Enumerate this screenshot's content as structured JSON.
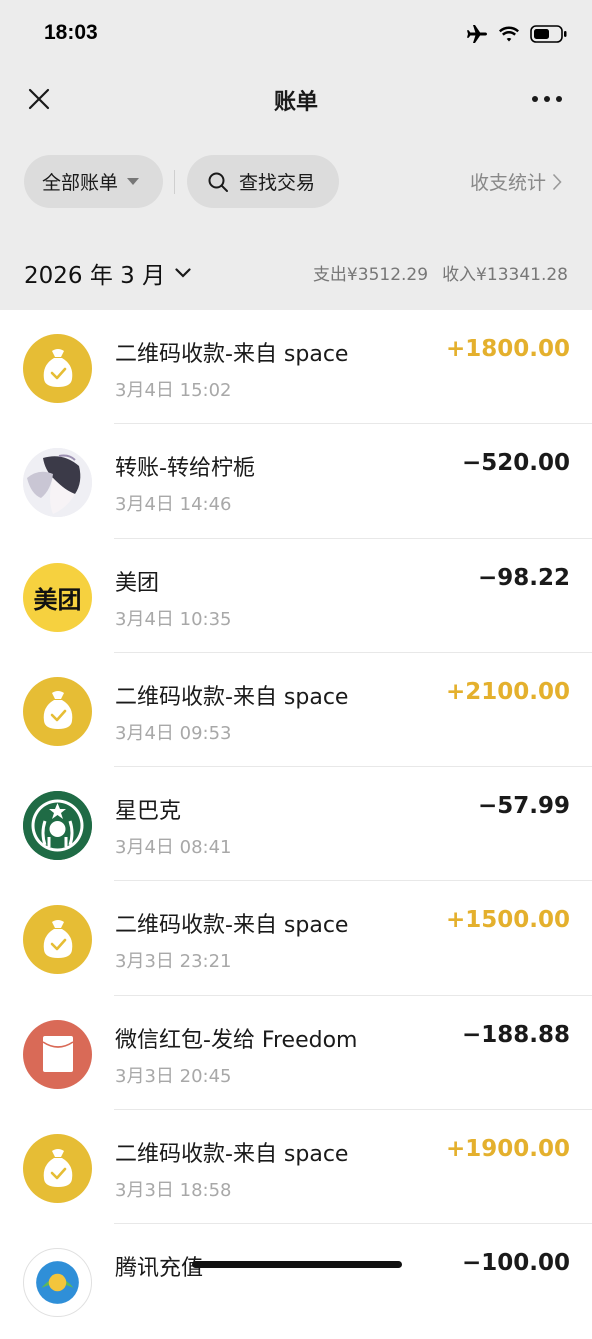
{
  "status_bar": {
    "time": "18:03"
  },
  "nav": {
    "title": "账单"
  },
  "filters": {
    "all_bills": "全部账单",
    "search": "查找交易",
    "stats": "收支统计"
  },
  "month": {
    "label": "2026 年 3 月",
    "expense": "支出¥3512.29",
    "income": "收入¥13341.28"
  },
  "transactions": [
    {
      "title": "二维码收款-来自 space",
      "time": "3月4日 15:02",
      "amount": "+1800.00",
      "icon": "money-bag-icon"
    },
    {
      "title": "转账-转给柠栀",
      "time": "3月4日 14:46",
      "amount": "−520.00",
      "icon": "contact-avatar"
    },
    {
      "title": "美团",
      "time": "3月4日 10:35",
      "amount": "−98.22",
      "icon": "meituan-logo",
      "logo_text": "美团"
    },
    {
      "title": "二维码收款-来自 space",
      "time": "3月4日 09:53",
      "amount": "+2100.00",
      "icon": "money-bag-icon"
    },
    {
      "title": "星巴克",
      "time": "3月4日 08:41",
      "amount": "−57.99",
      "icon": "starbucks-logo"
    },
    {
      "title": "二维码收款-来自 space",
      "time": "3月3日 23:21",
      "amount": "+1500.00",
      "icon": "money-bag-icon"
    },
    {
      "title": "微信红包-发给 Freedom",
      "time": "3月3日 20:45",
      "amount": "−188.88",
      "icon": "red-packet-icon"
    },
    {
      "title": "二维码收款-来自 space",
      "time": "3月3日 18:58",
      "amount": "+1900.00",
      "icon": "money-bag-icon"
    },
    {
      "title": "腾讯充值",
      "time": "",
      "amount": "−100.00",
      "icon": "tencent-recharge-icon"
    }
  ],
  "colors": {
    "income": "#e4b02d",
    "expense": "#1a1a1a",
    "header_bg": "#ececec",
    "money_bag": "#e6bd35",
    "red_packet": "#d96a57",
    "meituan": "#f6d13f",
    "starbucks": "#1f6b45"
  }
}
